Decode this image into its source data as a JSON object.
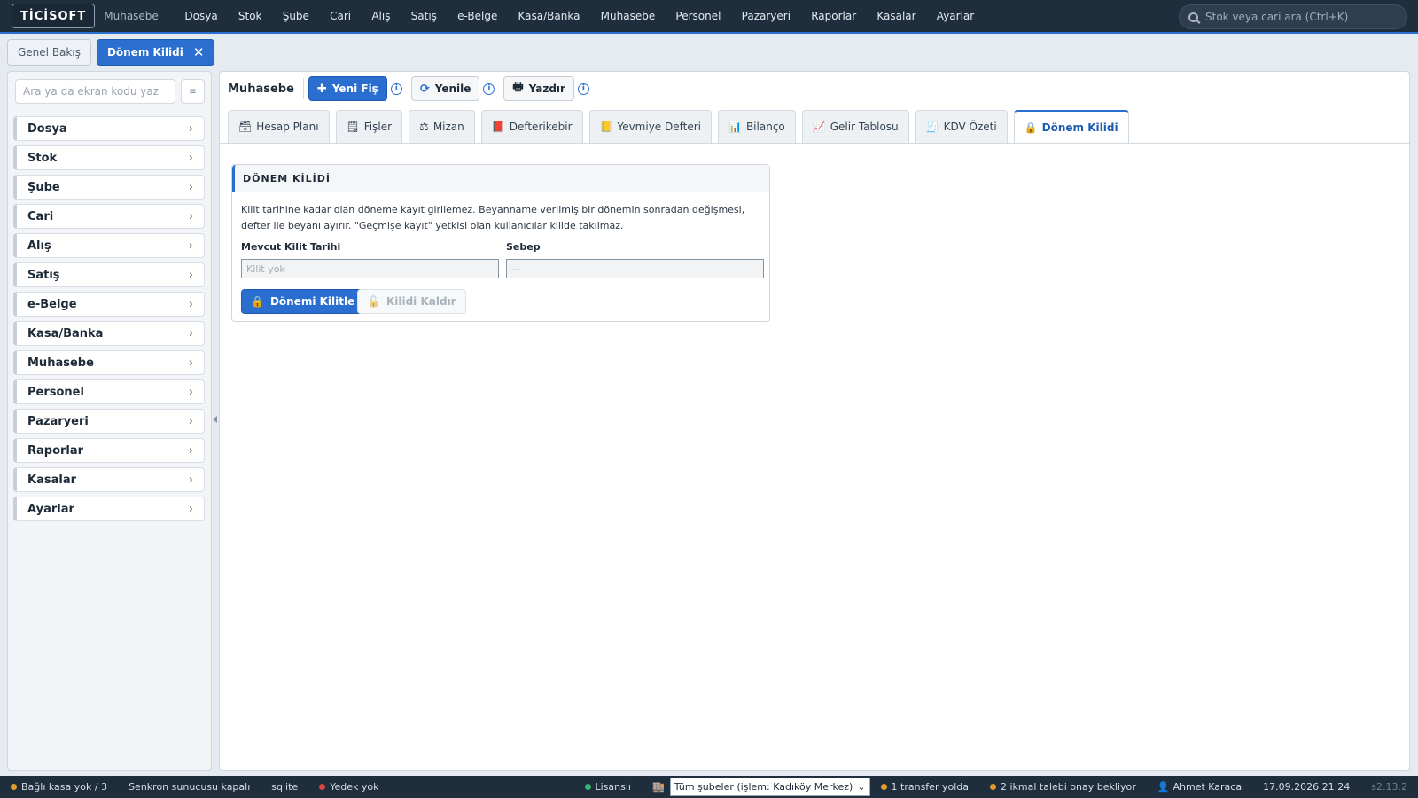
{
  "app": {
    "logo": "TİCİSOFT",
    "module": "Muhasebe"
  },
  "topnav": [
    "Dosya",
    "Stok",
    "Şube",
    "Cari",
    "Alış",
    "Satış",
    "e-Belge",
    "Kasa/Banka",
    "Muhasebe",
    "Personel",
    "Pazaryeri",
    "Raporlar",
    "Kasalar",
    "Ayarlar"
  ],
  "global_search": {
    "placeholder": "Stok veya cari ara (Ctrl+K)"
  },
  "page_tabs": {
    "overview": "Genel Bakış",
    "active": "Dönem Kilidi",
    "close": "✕"
  },
  "sidebar": {
    "search_placeholder": "Ara ya da ekran kodu yaz",
    "toggle_icon": "≡",
    "items": [
      "Dosya",
      "Stok",
      "Şube",
      "Cari",
      "Alış",
      "Satış",
      "e-Belge",
      "Kasa/Banka",
      "Muhasebe",
      "Personel",
      "Pazaryeri",
      "Raporlar",
      "Kasalar",
      "Ayarlar"
    ]
  },
  "toolbar": {
    "label": "Muhasebe",
    "new_voucher": "Yeni Fiş",
    "refresh": "Yenile",
    "print": "Yazdır"
  },
  "subtabs": [
    {
      "label": "Hesap Planı",
      "icon": "🗃"
    },
    {
      "label": "Fişler",
      "icon": "🗒"
    },
    {
      "label": "Mizan",
      "icon": "⚖"
    },
    {
      "label": "Defterikebir",
      "icon": "📕"
    },
    {
      "label": "Yevmiye Defteri",
      "icon": "📒"
    },
    {
      "label": "Bilanço",
      "icon": "📊"
    },
    {
      "label": "Gelir Tablosu",
      "icon": "📈"
    },
    {
      "label": "KDV Özeti",
      "icon": "🧾"
    },
    {
      "label": "Dönem Kilidi",
      "icon": "🔒"
    }
  ],
  "panel": {
    "title": "DÖNEM KİLİDİ",
    "description": "Kilit tarihine kadar olan döneme kayıt girilemez. Beyanname verilmiş bir dönemin sonradan değişmesi, defter ile beyanı ayırır. \"Geçmişe kayıt\" yetkisi olan kullanıcılar kilide takılmaz.",
    "current_lock_label": "Mevcut Kilit Tarihi",
    "current_lock_value": "Kilit yok",
    "reason_label": "Sebep",
    "reason_value": "—",
    "lock_button": "Dönemi Kilitle",
    "unlock_button": "Kilidi Kaldır"
  },
  "statusbar": {
    "cash_registers": "Bağlı kasa yok / 3",
    "sync": "Senkron sunucusu kapalı",
    "db": "sqlite",
    "backup": "Yedek yok",
    "license": "Lisanslı",
    "branch_select": "Tüm şubeler (işlem: Kadıköy Merkez)",
    "transfers": "1 transfer yolda",
    "requests": "2 ikmal talebi onay bekliyor",
    "user": "Ahmet Karaca",
    "datetime": "17.09.2026 21:24",
    "version": "s2.13.2"
  },
  "colors": {
    "accent": "#2a6fd0",
    "topbar": "#1f2e3d",
    "ok": "#3cb371",
    "warn": "#e69a2e",
    "error": "#d9453d"
  }
}
